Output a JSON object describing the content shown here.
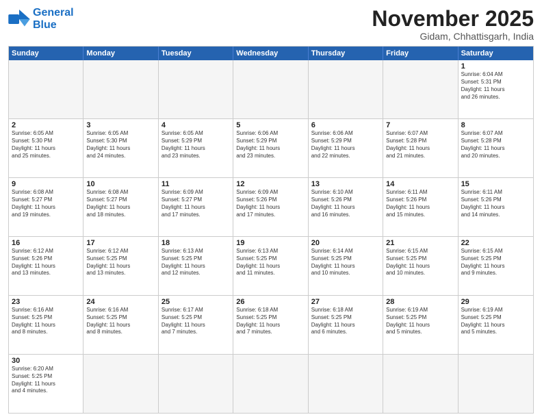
{
  "header": {
    "logo_general": "General",
    "logo_blue": "Blue",
    "month_title": "November 2025",
    "location": "Gidam, Chhattisgarh, India"
  },
  "days_of_week": [
    "Sunday",
    "Monday",
    "Tuesday",
    "Wednesday",
    "Thursday",
    "Friday",
    "Saturday"
  ],
  "weeks": [
    [
      {
        "day": "",
        "info": ""
      },
      {
        "day": "",
        "info": ""
      },
      {
        "day": "",
        "info": ""
      },
      {
        "day": "",
        "info": ""
      },
      {
        "day": "",
        "info": ""
      },
      {
        "day": "",
        "info": ""
      },
      {
        "day": "1",
        "info": "Sunrise: 6:04 AM\nSunset: 5:31 PM\nDaylight: 11 hours\nand 26 minutes."
      }
    ],
    [
      {
        "day": "2",
        "info": "Sunrise: 6:05 AM\nSunset: 5:30 PM\nDaylight: 11 hours\nand 25 minutes."
      },
      {
        "day": "3",
        "info": "Sunrise: 6:05 AM\nSunset: 5:30 PM\nDaylight: 11 hours\nand 24 minutes."
      },
      {
        "day": "4",
        "info": "Sunrise: 6:05 AM\nSunset: 5:29 PM\nDaylight: 11 hours\nand 23 minutes."
      },
      {
        "day": "5",
        "info": "Sunrise: 6:06 AM\nSunset: 5:29 PM\nDaylight: 11 hours\nand 23 minutes."
      },
      {
        "day": "6",
        "info": "Sunrise: 6:06 AM\nSunset: 5:29 PM\nDaylight: 11 hours\nand 22 minutes."
      },
      {
        "day": "7",
        "info": "Sunrise: 6:07 AM\nSunset: 5:28 PM\nDaylight: 11 hours\nand 21 minutes."
      },
      {
        "day": "8",
        "info": "Sunrise: 6:07 AM\nSunset: 5:28 PM\nDaylight: 11 hours\nand 20 minutes."
      }
    ],
    [
      {
        "day": "9",
        "info": "Sunrise: 6:08 AM\nSunset: 5:27 PM\nDaylight: 11 hours\nand 19 minutes."
      },
      {
        "day": "10",
        "info": "Sunrise: 6:08 AM\nSunset: 5:27 PM\nDaylight: 11 hours\nand 18 minutes."
      },
      {
        "day": "11",
        "info": "Sunrise: 6:09 AM\nSunset: 5:27 PM\nDaylight: 11 hours\nand 17 minutes."
      },
      {
        "day": "12",
        "info": "Sunrise: 6:09 AM\nSunset: 5:26 PM\nDaylight: 11 hours\nand 17 minutes."
      },
      {
        "day": "13",
        "info": "Sunrise: 6:10 AM\nSunset: 5:26 PM\nDaylight: 11 hours\nand 16 minutes."
      },
      {
        "day": "14",
        "info": "Sunrise: 6:11 AM\nSunset: 5:26 PM\nDaylight: 11 hours\nand 15 minutes."
      },
      {
        "day": "15",
        "info": "Sunrise: 6:11 AM\nSunset: 5:26 PM\nDaylight: 11 hours\nand 14 minutes."
      }
    ],
    [
      {
        "day": "16",
        "info": "Sunrise: 6:12 AM\nSunset: 5:26 PM\nDaylight: 11 hours\nand 13 minutes."
      },
      {
        "day": "17",
        "info": "Sunrise: 6:12 AM\nSunset: 5:25 PM\nDaylight: 11 hours\nand 13 minutes."
      },
      {
        "day": "18",
        "info": "Sunrise: 6:13 AM\nSunset: 5:25 PM\nDaylight: 11 hours\nand 12 minutes."
      },
      {
        "day": "19",
        "info": "Sunrise: 6:13 AM\nSunset: 5:25 PM\nDaylight: 11 hours\nand 11 minutes."
      },
      {
        "day": "20",
        "info": "Sunrise: 6:14 AM\nSunset: 5:25 PM\nDaylight: 11 hours\nand 10 minutes."
      },
      {
        "day": "21",
        "info": "Sunrise: 6:15 AM\nSunset: 5:25 PM\nDaylight: 11 hours\nand 10 minutes."
      },
      {
        "day": "22",
        "info": "Sunrise: 6:15 AM\nSunset: 5:25 PM\nDaylight: 11 hours\nand 9 minutes."
      }
    ],
    [
      {
        "day": "23",
        "info": "Sunrise: 6:16 AM\nSunset: 5:25 PM\nDaylight: 11 hours\nand 8 minutes."
      },
      {
        "day": "24",
        "info": "Sunrise: 6:16 AM\nSunset: 5:25 PM\nDaylight: 11 hours\nand 8 minutes."
      },
      {
        "day": "25",
        "info": "Sunrise: 6:17 AM\nSunset: 5:25 PM\nDaylight: 11 hours\nand 7 minutes."
      },
      {
        "day": "26",
        "info": "Sunrise: 6:18 AM\nSunset: 5:25 PM\nDaylight: 11 hours\nand 7 minutes."
      },
      {
        "day": "27",
        "info": "Sunrise: 6:18 AM\nSunset: 5:25 PM\nDaylight: 11 hours\nand 6 minutes."
      },
      {
        "day": "28",
        "info": "Sunrise: 6:19 AM\nSunset: 5:25 PM\nDaylight: 11 hours\nand 5 minutes."
      },
      {
        "day": "29",
        "info": "Sunrise: 6:19 AM\nSunset: 5:25 PM\nDaylight: 11 hours\nand 5 minutes."
      }
    ],
    [
      {
        "day": "30",
        "info": "Sunrise: 6:20 AM\nSunset: 5:25 PM\nDaylight: 11 hours\nand 4 minutes."
      },
      {
        "day": "",
        "info": ""
      },
      {
        "day": "",
        "info": ""
      },
      {
        "day": "",
        "info": ""
      },
      {
        "day": "",
        "info": ""
      },
      {
        "day": "",
        "info": ""
      },
      {
        "day": "",
        "info": ""
      }
    ]
  ]
}
